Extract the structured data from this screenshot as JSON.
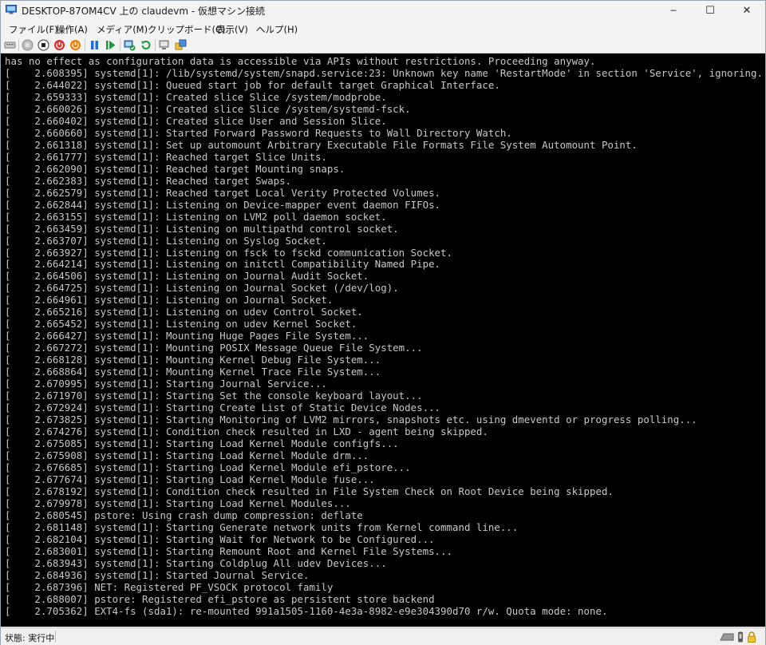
{
  "window": {
    "title": "DESKTOP-87OM4CV 上の claudevm - 仮想マシン接続",
    "minimize_glyph": "─",
    "maximize_glyph": "☐",
    "close_glyph": "✕"
  },
  "menu": {
    "items": [
      "ファイル(F)",
      "操作(A)",
      "メディア(M)",
      "クリップボード(C)",
      "表示(V)",
      "ヘルプ(H)"
    ]
  },
  "toolbar": {
    "icons": [
      "ctrl-alt-del-icon",
      "start-icon",
      "turn-off-icon",
      "shutdown-icon",
      "save-icon",
      "pause-icon",
      "resume-icon",
      "checkpoint-icon",
      "revert-icon",
      "enhanced-session-icon",
      "share-icon"
    ],
    "colors": {
      "power_red": "#d32f2f",
      "save_orange": "#f57c00",
      "pause_blue": "#1e6fd9",
      "resume_green": "#1a9a3a"
    }
  },
  "console": {
    "text_color": "#c8c8c8",
    "background": "#000000",
    "lines": [
      "has no effect as configuration data is accessible via APIs without restrictions. Proceeding anyway.",
      "[    2.608395] systemd[1]: /lib/systemd/system/snapd.service:23: Unknown key name 'RestartMode' in section 'Service', ignoring.",
      "[    2.644022] systemd[1]: Queued start job for default target Graphical Interface.",
      "[    2.659333] systemd[1]: Created slice Slice /system/modprobe.",
      "[    2.660026] systemd[1]: Created slice Slice /system/systemd-fsck.",
      "[    2.660402] systemd[1]: Created slice User and Session Slice.",
      "[    2.660660] systemd[1]: Started Forward Password Requests to Wall Directory Watch.",
      "[    2.661318] systemd[1]: Set up automount Arbitrary Executable File Formats File System Automount Point.",
      "[    2.661777] systemd[1]: Reached target Slice Units.",
      "[    2.662090] systemd[1]: Reached target Mounting snaps.",
      "[    2.662383] systemd[1]: Reached target Swaps.",
      "[    2.662579] systemd[1]: Reached target Local Verity Protected Volumes.",
      "[    2.662844] systemd[1]: Listening on Device-mapper event daemon FIFOs.",
      "[    2.663155] systemd[1]: Listening on LVM2 poll daemon socket.",
      "[    2.663459] systemd[1]: Listening on multipathd control socket.",
      "[    2.663707] systemd[1]: Listening on Syslog Socket.",
      "[    2.663927] systemd[1]: Listening on fsck to fsckd communication Socket.",
      "[    2.664214] systemd[1]: Listening on initctl Compatibility Named Pipe.",
      "[    2.664506] systemd[1]: Listening on Journal Audit Socket.",
      "[    2.664725] systemd[1]: Listening on Journal Socket (/dev/log).",
      "[    2.664961] systemd[1]: Listening on Journal Socket.",
      "[    2.665216] systemd[1]: Listening on udev Control Socket.",
      "[    2.665452] systemd[1]: Listening on udev Kernel Socket.",
      "[    2.666427] systemd[1]: Mounting Huge Pages File System...",
      "[    2.667272] systemd[1]: Mounting POSIX Message Queue File System...",
      "[    2.668128] systemd[1]: Mounting Kernel Debug File System...",
      "[    2.668864] systemd[1]: Mounting Kernel Trace File System...",
      "[    2.670995] systemd[1]: Starting Journal Service...",
      "[    2.671970] systemd[1]: Starting Set the console keyboard layout...",
      "[    2.672924] systemd[1]: Starting Create List of Static Device Nodes...",
      "[    2.673825] systemd[1]: Starting Monitoring of LVM2 mirrors, snapshots etc. using dmeventd or progress polling...",
      "[    2.674276] systemd[1]: Condition check resulted in LXD - agent being skipped.",
      "[    2.675085] systemd[1]: Starting Load Kernel Module configfs...",
      "[    2.675908] systemd[1]: Starting Load Kernel Module drm...",
      "[    2.676685] systemd[1]: Starting Load Kernel Module efi_pstore...",
      "[    2.677674] systemd[1]: Starting Load Kernel Module fuse...",
      "[    2.678192] systemd[1]: Condition check resulted in File System Check on Root Device being skipped.",
      "[    2.679978] systemd[1]: Starting Load Kernel Modules...",
      "[    2.680545] pstore: Using crash dump compression: deflate",
      "[    2.681148] systemd[1]: Starting Generate network units from Kernel command line...",
      "[    2.682104] systemd[1]: Starting Wait for Network to be Configured...",
      "[    2.683001] systemd[1]: Starting Remount Root and Kernel File Systems...",
      "[    2.683943] systemd[1]: Starting Coldplug All udev Devices...",
      "[    2.684936] systemd[1]: Started Journal Service.",
      "[    2.687396] NET: Registered PF_VSOCK protocol family",
      "[    2.688007] pstore: Registered efi_pstore as persistent store backend",
      "[    2.705362] EXT4-fs (sda1): re-mounted 991a1505-1160-4e3a-8982-e9e304390d70 r/w. Quota mode: none."
    ]
  },
  "status": {
    "text": "状態: 実行中",
    "icons": [
      "keyboard-icon",
      "audio-icon",
      "lock-icon"
    ]
  }
}
